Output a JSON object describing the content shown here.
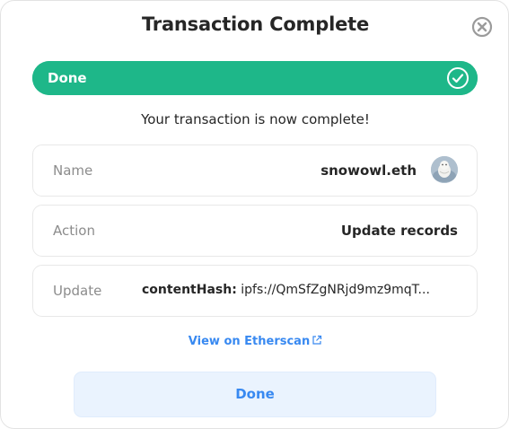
{
  "modal": {
    "title": "Transaction Complete"
  },
  "progress": {
    "label": "Done",
    "fraction": 1.0,
    "color": "#1eb789"
  },
  "message": "Your transaction is now complete!",
  "details": {
    "name": {
      "label": "Name",
      "value": "snowowl.eth"
    },
    "action": {
      "label": "Action",
      "value": "Update records"
    },
    "update": {
      "label": "Update",
      "key": "contentHash:",
      "value": "ipfs://QmSfZgNRjd9mz9mqT..."
    }
  },
  "link": {
    "label": "View on Etherscan",
    "icon": "external-link-icon"
  },
  "button": {
    "label": "Done"
  },
  "colors": {
    "accent": "#3889f1",
    "success": "#1eb789",
    "button_bg": "#eaf3fe"
  }
}
